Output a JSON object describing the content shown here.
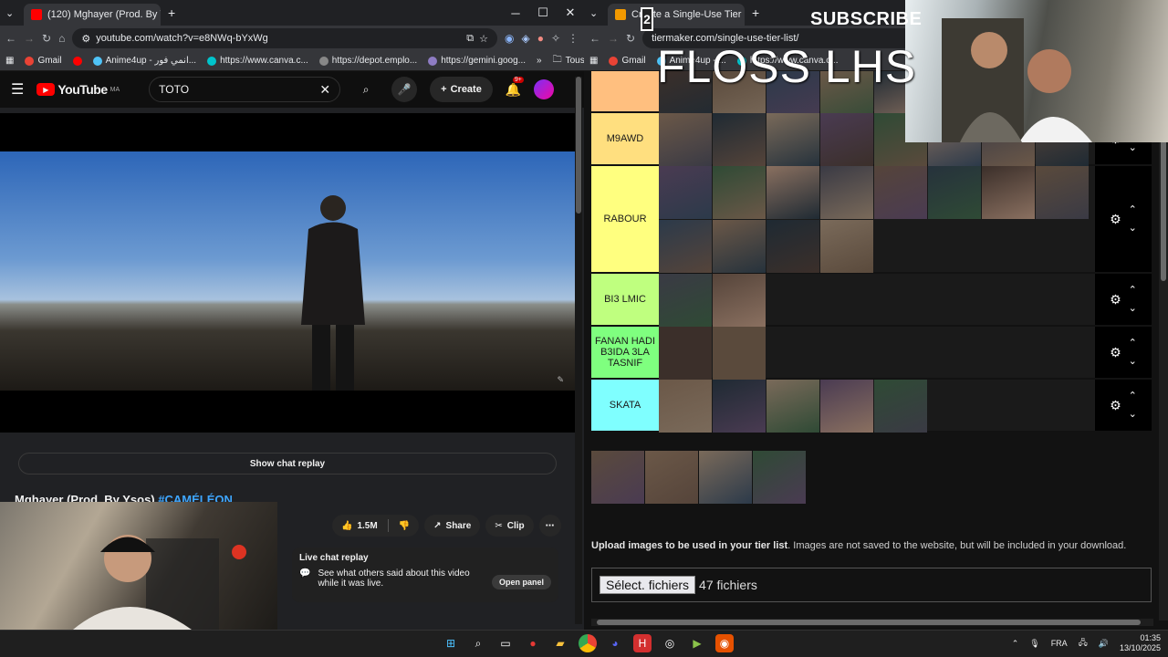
{
  "left_browser": {
    "tab_title": "(120) Mghayer (Prod. By Ys",
    "url": "youtube.com/watch?v=e8NWq-bYxWg",
    "bookmarks": [
      "Gmail",
      "",
      "Anime4up - انمي فور...",
      "https://www.canva.c...",
      "https://depot.emplo...",
      "https://gemini.goog..."
    ],
    "more_bookmarks": "Tous les favoris"
  },
  "youtube": {
    "logo": "YouTube",
    "region": "MA",
    "search_value": "TOTO",
    "create_label": "Create",
    "notif_count": "9+",
    "show_chat_replay": "Show chat replay",
    "video_title": "Mghayer (Prod. By Ysos)",
    "video_tag": "#CAMÉLÉON",
    "likes": "1.5M",
    "share": "Share",
    "clip": "Clip",
    "live_chat_title": "Live chat replay",
    "live_chat_text": "See what others said about this video while it was live.",
    "open_panel": "Open panel"
  },
  "right_browser": {
    "tab_title": "Create a Single-Use Tier List (P",
    "url": "tiermaker.com/single-use-tier-list/",
    "bookmarks": [
      "Gmail",
      "Anime4up - ...",
      "https://www.canva.c..."
    ]
  },
  "overlay": {
    "subscribe": "SUBSCRIBE",
    "floss": "FLOSS LHS",
    "badge": "2"
  },
  "tierlist": {
    "rows": [
      {
        "label": "",
        "color": "#ffbf7f",
        "count": 5
      },
      {
        "label": "M9AWD",
        "color": "#ffdf7f",
        "count": 8
      },
      {
        "label": "RABOUR",
        "color": "#ffff7f",
        "count": 12
      },
      {
        "label": "BI3 LMIC",
        "color": "#bfff7f",
        "count": 2
      },
      {
        "label": "FANAN HADI B3IDA 3LA TASNIF",
        "color": "#7fff7f",
        "count": 2
      },
      {
        "label": "SKATA",
        "color": "#7fffff",
        "count": 5
      }
    ],
    "pool_count": 4,
    "upload_bold": "Upload images to be used in your tier list",
    "upload_rest": ". Images are not saved to the website, but will be included in your download.",
    "file_button": "Sélect. fichiers",
    "file_count": "47 fichiers"
  },
  "taskbar": {
    "lang": "FRA",
    "time": "01:35",
    "date": "13/10/2025"
  }
}
